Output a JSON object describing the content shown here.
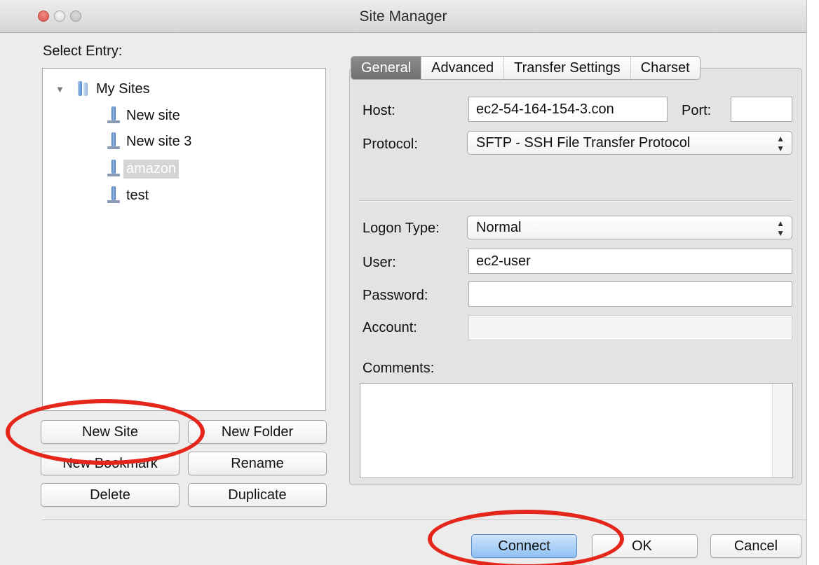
{
  "window": {
    "title": "Site Manager"
  },
  "sidebar": {
    "label": "Select Entry:",
    "root": {
      "label": "My Sites",
      "expanded": true
    },
    "sites": [
      {
        "label": "New site",
        "selected": false
      },
      {
        "label": "New site 3",
        "selected": false
      },
      {
        "label": "amazon",
        "selected": true
      },
      {
        "label": "test",
        "selected": false
      }
    ],
    "buttons": {
      "new_site": "New Site",
      "new_folder": "New Folder",
      "new_bookmark": "New Bookmark",
      "rename": "Rename",
      "delete": "Delete",
      "duplicate": "Duplicate"
    }
  },
  "tabs": [
    {
      "label": "General",
      "active": true
    },
    {
      "label": "Advanced",
      "active": false
    },
    {
      "label": "Transfer Settings",
      "active": false
    },
    {
      "label": "Charset",
      "active": false
    }
  ],
  "general": {
    "host_label": "Host:",
    "host_value": "ec2-54-164-154-3.con",
    "port_label": "Port:",
    "port_value": "",
    "protocol_label": "Protocol:",
    "protocol_value": "SFTP - SSH File Transfer Protocol",
    "logon_type_label": "Logon Type:",
    "logon_type_value": "Normal",
    "user_label": "User:",
    "user_value": "ec2-user",
    "password_label": "Password:",
    "password_value": "",
    "account_label": "Account:",
    "account_value": "",
    "comments_label": "Comments:",
    "comments_value": ""
  },
  "footer": {
    "connect": "Connect",
    "ok": "OK",
    "cancel": "Cancel"
  },
  "colors": {
    "annotation": "#e4261b",
    "primary_button": "#8ec0f3"
  }
}
